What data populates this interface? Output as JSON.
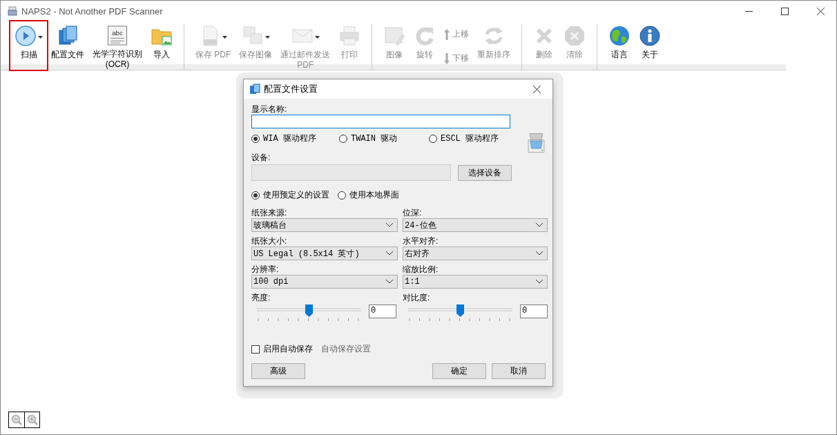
{
  "window": {
    "title": "NAPS2 - Not Another PDF Scanner"
  },
  "toolbar": {
    "groups": [
      {
        "items": [
          {
            "kind": "split",
            "label": "扫描",
            "disabled": false,
            "highlighted": true
          },
          {
            "kind": "button",
            "label": "配置文件",
            "disabled": false,
            "highlighted": false
          },
          {
            "kind": "button",
            "label": "光学字符识别\n(OCR)",
            "icon_text": "abc",
            "disabled": false,
            "highlighted": false
          },
          {
            "kind": "button",
            "label": "导入",
            "disabled": false,
            "highlighted": false
          }
        ]
      },
      {
        "items": [
          {
            "kind": "split",
            "label": "保存 PDF",
            "disabled": true,
            "highlighted": false
          },
          {
            "kind": "split",
            "label": "保存图像",
            "disabled": true,
            "highlighted": false
          },
          {
            "kind": "split",
            "label": "通过邮件发送\nPDF",
            "disabled": true,
            "highlighted": false
          },
          {
            "kind": "button",
            "label": "打印",
            "disabled": true,
            "highlighted": false
          }
        ]
      },
      {
        "items": [
          {
            "kind": "button",
            "label": "图像",
            "disabled": true,
            "highlighted": false
          },
          {
            "kind": "button",
            "label": "旋转",
            "disabled": true,
            "highlighted": false
          },
          {
            "kind": "stack",
            "label": "上移",
            "label2": "下移",
            "disabled": true,
            "highlighted": false
          },
          {
            "kind": "button",
            "label": "重新排序",
            "disabled": true,
            "highlighted": false
          }
        ]
      },
      {
        "items": [
          {
            "kind": "button",
            "label": "删除",
            "disabled": true,
            "highlighted": false
          },
          {
            "kind": "button",
            "label": "清除",
            "disabled": true,
            "highlighted": false
          }
        ]
      },
      {
        "items": [
          {
            "kind": "button",
            "label": "语言",
            "disabled": false,
            "highlighted": false
          },
          {
            "kind": "button",
            "label": "关于",
            "disabled": false,
            "highlighted": false
          }
        ]
      }
    ]
  },
  "dialog": {
    "title": "配置文件设置",
    "name_label": "显示名称:",
    "drivers": [
      {
        "label": "WIA 驱动程序",
        "selected": true
      },
      {
        "label": "TWAIN 驱动",
        "selected": false
      },
      {
        "label": "ESCL 驱动程序",
        "selected": false
      }
    ],
    "device_label": "设备:",
    "device_button": "选择设备",
    "modes": [
      {
        "label": "使用预定义的设置",
        "selected": true
      },
      {
        "label": "使用本地界面",
        "selected": false
      }
    ],
    "combos": [
      {
        "label": "纸张来源:",
        "value": "玻璃稿台"
      },
      {
        "label": "位深:",
        "value": "24-位色"
      },
      {
        "label": "纸张大小:",
        "value": "US Legal (8.5x14 英寸)"
      },
      {
        "label": "水平对齐:",
        "value": "右对齐"
      },
      {
        "label": "分辨率:",
        "value": "100 dpi"
      },
      {
        "label": "缩放比例:",
        "value": "1:1"
      }
    ],
    "sliders": [
      {
        "label": "亮度:",
        "level": 0.5,
        "value": "0"
      },
      {
        "label": "对比度:",
        "level": 0.5,
        "value": "0"
      }
    ],
    "autosave": {
      "label": "启用自动保存",
      "checked": false
    },
    "autosave_settings": {
      "label": "自动保存设置",
      "disabled": true
    },
    "buttons": [
      "高级",
      "确定",
      "取消"
    ]
  }
}
